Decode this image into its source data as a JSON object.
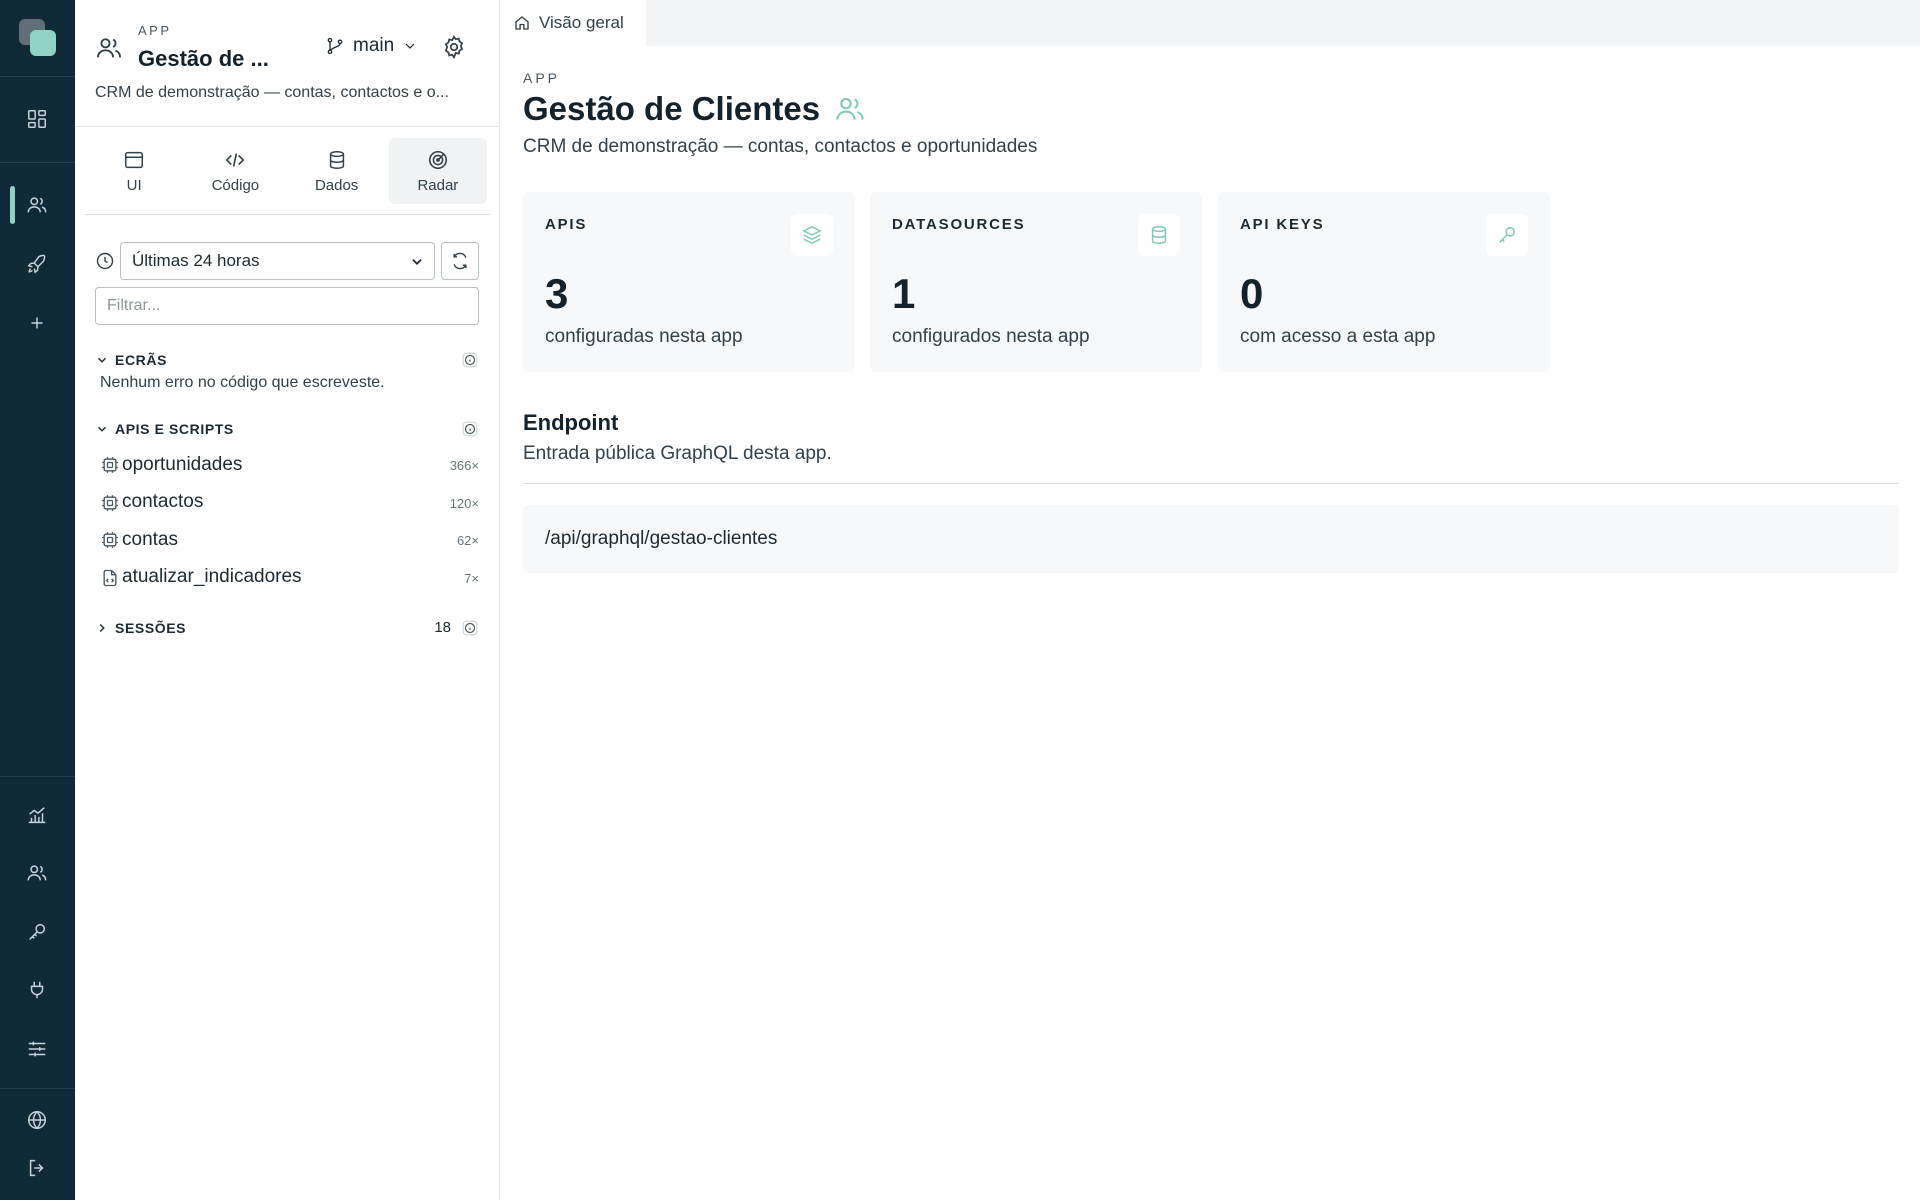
{
  "rail": {
    "top_items": [
      {
        "name": "dashboard-icon",
        "label": "dashboard"
      },
      {
        "name": "users-icon",
        "label": "apps"
      },
      {
        "name": "rocket-icon",
        "label": "deploy"
      },
      {
        "name": "plus-icon",
        "label": "new"
      }
    ],
    "bottom_items": [
      {
        "name": "analytics-icon"
      },
      {
        "name": "team-icon"
      },
      {
        "name": "key-icon"
      },
      {
        "name": "plug-icon"
      },
      {
        "name": "sliders-icon"
      },
      {
        "name": "globe-icon"
      },
      {
        "name": "logout-icon"
      }
    ],
    "accent": "#8fd3c3"
  },
  "sidebar": {
    "kicker": "APP",
    "title": "Gestão de ...",
    "branch": "main",
    "description": "CRM de demonstração — contas, contactos e o...",
    "modes": [
      {
        "label": "UI",
        "icon": "browser-window-icon"
      },
      {
        "label": "Código",
        "icon": "code-icon"
      },
      {
        "label": "Dados",
        "icon": "database-icon"
      },
      {
        "label": "Radar",
        "icon": "radar-icon",
        "active": true
      }
    ],
    "time_range": "Últimas 24 horas",
    "filter_placeholder": "Filtrar...",
    "screens": {
      "header": "ECRÃS",
      "empty_text": "Nenhum erro no código que escreveste."
    },
    "apis": {
      "header": "APIS E SCRIPTS",
      "items": [
        {
          "name": "oportunidades",
          "calls": "366×",
          "icon": "cpu-icon"
        },
        {
          "name": "contactos",
          "calls": "120×",
          "icon": "cpu-icon"
        },
        {
          "name": "contas",
          "calls": "62×",
          "icon": "cpu-icon"
        },
        {
          "name": "atualizar_indicadores",
          "calls": "7×",
          "icon": "script-file-icon"
        }
      ]
    },
    "sessions": {
      "header": "SESSÕES",
      "count": "18"
    }
  },
  "tabs": [
    {
      "label": "Visão geral",
      "icon": "home-icon"
    }
  ],
  "main": {
    "kicker": "APP",
    "title": "Gestão de Clientes",
    "description": "CRM de demonstração — contas, contactos e oportunidades",
    "cards": [
      {
        "label": "APIS",
        "value": "3",
        "sub": "configuradas nesta app",
        "icon": "layers-icon"
      },
      {
        "label": "DATASOURCES",
        "value": "1",
        "sub": "configurados nesta app",
        "icon": "database-icon"
      },
      {
        "label": "API KEYS",
        "value": "0",
        "sub": "com acesso a esta app",
        "icon": "key-icon"
      }
    ],
    "endpoint": {
      "title": "Endpoint",
      "description": "Entrada pública GraphQL desta app.",
      "path": "/api/graphql/gestao-clientes"
    },
    "accent": "#7fc9b6"
  }
}
